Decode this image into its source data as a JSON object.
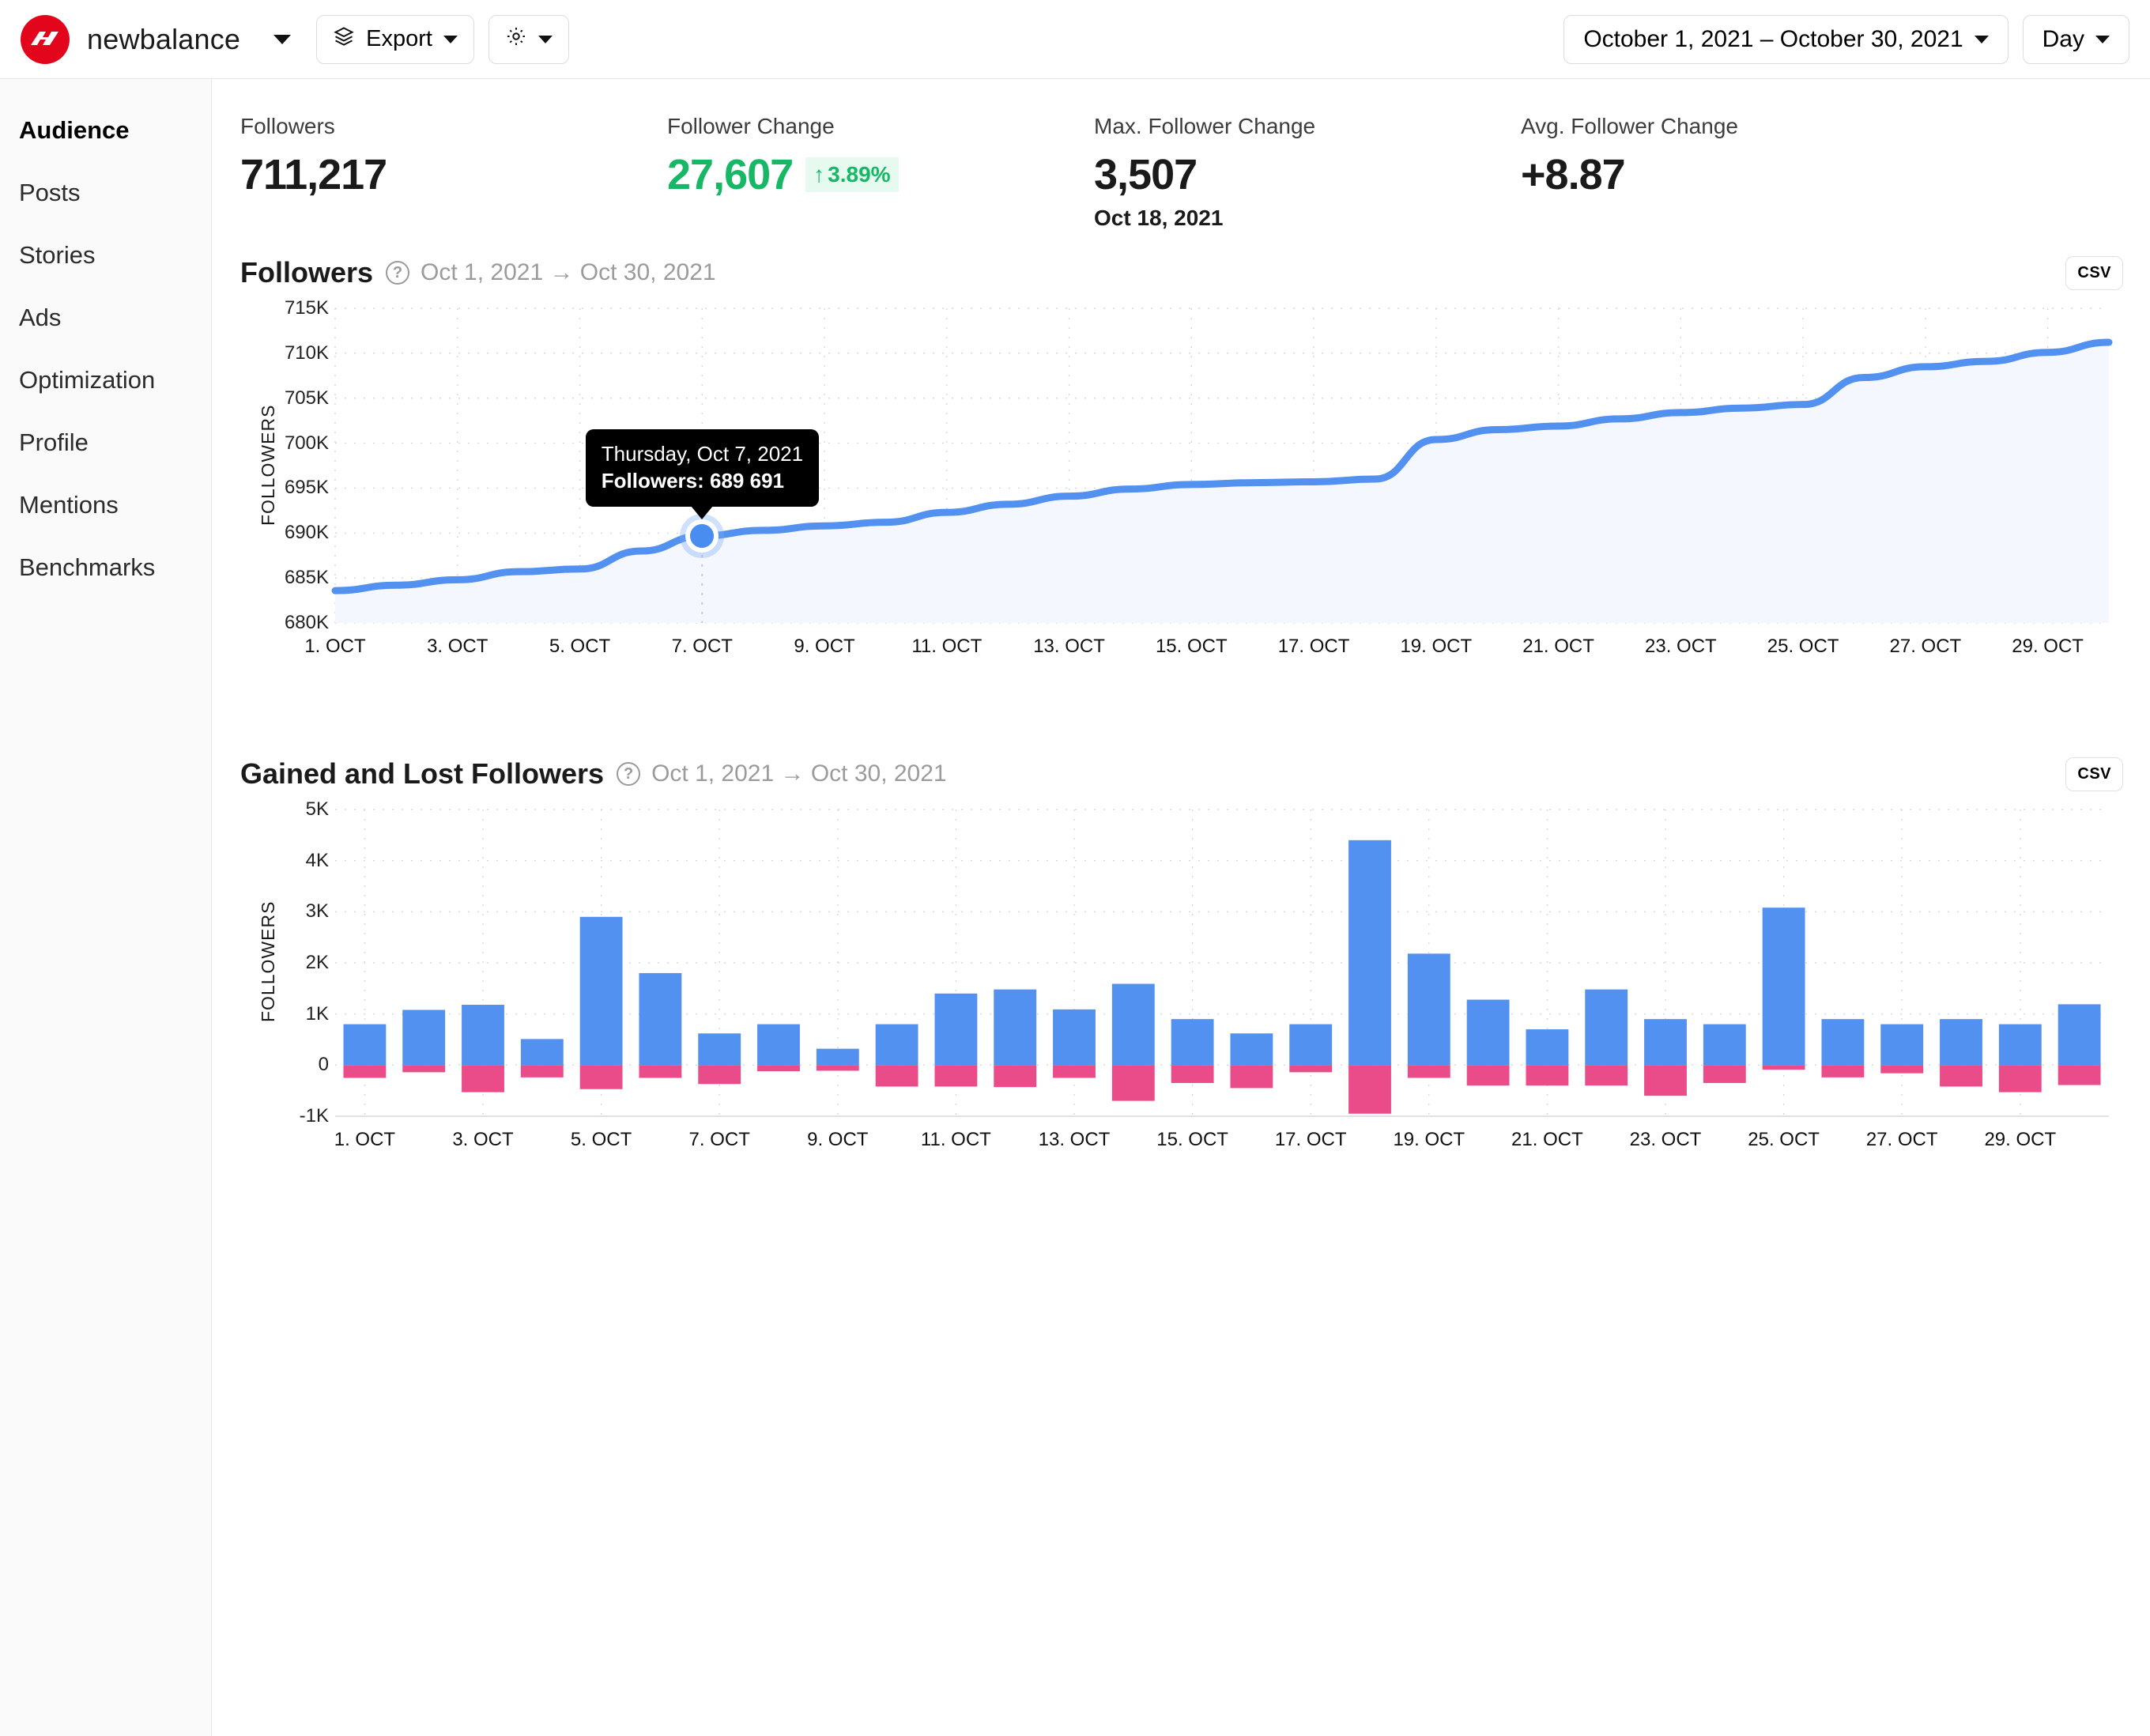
{
  "header": {
    "brand_name": "newbalance",
    "brand_logo_icon": "new-balance-logo",
    "brand_caret_icon": "chevron-down-icon",
    "export_label": "Export",
    "export_icon": "layers-icon",
    "export_caret_icon": "chevron-down-icon",
    "settings_icon": "gear-icon",
    "settings_caret_icon": "chevron-down-icon",
    "date_range": "October 1, 2021 – October 30, 2021",
    "date_range_caret_icon": "chevron-down-icon",
    "granularity": "Day",
    "granularity_caret_icon": "chevron-down-icon"
  },
  "sidebar": {
    "items": [
      {
        "label": "Audience",
        "active": true
      },
      {
        "label": "Posts",
        "active": false
      },
      {
        "label": "Stories",
        "active": false
      },
      {
        "label": "Ads",
        "active": false
      },
      {
        "label": "Optimization",
        "active": false
      },
      {
        "label": "Profile",
        "active": false
      },
      {
        "label": "Mentions",
        "active": false
      },
      {
        "label": "Benchmarks",
        "active": false
      }
    ]
  },
  "kpis": [
    {
      "label": "Followers",
      "value": "711,217",
      "badge": "",
      "sub": ""
    },
    {
      "label": "Follower Change",
      "value": "27,607",
      "badge": "3.89%",
      "badge_arrow": "↑",
      "sub": ""
    },
    {
      "label": "Max. Follower Change",
      "value": "3,507",
      "badge": "",
      "sub": "Oct 18, 2021"
    },
    {
      "label": "Avg. Follower Change",
      "value": "+8.87",
      "badge": "",
      "sub": ""
    }
  ],
  "colors": {
    "accent_blue": "#5291f0",
    "accent_pink": "#ea4c89",
    "positive_green": "#16b866",
    "positive_green_bg": "#e6faef",
    "brand_red": "#e3051b"
  },
  "followers_chart": {
    "title": "Followers",
    "help_icon": "question-circle-icon",
    "range": "Oct 1, 2021 → Oct 30, 2021",
    "csv_label": "CSV",
    "tooltip": {
      "date": "Thursday, Oct 7, 2021",
      "value": "Followers: 689 691"
    }
  },
  "gained_lost_chart": {
    "title": "Gained and Lost Followers",
    "help_icon": "question-circle-icon",
    "range": "Oct 1, 2021 → Oct 30, 2021",
    "csv_label": "CSV"
  },
  "chart_data": [
    {
      "type": "area",
      "title": "Followers",
      "xlabel": "",
      "ylabel": "FOLLOWERS",
      "ylim": [
        680000,
        715000
      ],
      "yticks": [
        680000,
        685000,
        690000,
        695000,
        700000,
        705000,
        710000,
        715000
      ],
      "ytick_labels": [
        "680K",
        "685K",
        "690K",
        "695K",
        "700K",
        "705K",
        "710K",
        "715K"
      ],
      "grid": true,
      "legend": "none",
      "x": [
        "1. OCT",
        "2. OCT",
        "3. OCT",
        "4. OCT",
        "5. OCT",
        "6. OCT",
        "7. OCT",
        "8. OCT",
        "9. OCT",
        "10. OCT",
        "11. OCT",
        "12. OCT",
        "13. OCT",
        "14. OCT",
        "15. OCT",
        "16. OCT",
        "17. OCT",
        "18. OCT",
        "19. OCT",
        "20. OCT",
        "21. OCT",
        "22. OCT",
        "23. OCT",
        "24. OCT",
        "25. OCT",
        "26. OCT",
        "27. OCT",
        "28. OCT",
        "29. OCT",
        "30. OCT"
      ],
      "xtick_labels": [
        "1. OCT",
        "3. OCT",
        "5. OCT",
        "7. OCT",
        "9. OCT",
        "11. OCT",
        "13. OCT",
        "15. OCT",
        "17. OCT",
        "19. OCT",
        "21. OCT",
        "23. OCT",
        "25. OCT",
        "27. OCT",
        "29. OCT"
      ],
      "series": [
        {
          "name": "Followers",
          "color": "#5291f0",
          "values": [
            683600,
            684200,
            684800,
            685700,
            686000,
            688000,
            689691,
            690300,
            690800,
            691200,
            692300,
            693200,
            694100,
            694900,
            695400,
            695600,
            695700,
            696000,
            700400,
            701500,
            701900,
            702700,
            703400,
            703900,
            704300,
            707300,
            708500,
            709100,
            710100,
            711217
          ]
        }
      ],
      "highlight_point": {
        "x": "7. OCT",
        "y": 689691,
        "label_date": "Thursday, Oct 7, 2021",
        "label_value": "Followers: 689 691"
      }
    },
    {
      "type": "bar",
      "title": "Gained and Lost Followers",
      "xlabel": "",
      "ylabel": "FOLLOWERS",
      "ylim": [
        -1000,
        5000
      ],
      "yticks": [
        -1000,
        0,
        1000,
        2000,
        3000,
        4000,
        5000
      ],
      "ytick_labels": [
        "-1K",
        "0",
        "1K",
        "2K",
        "3K",
        "4K",
        "5K"
      ],
      "grid": true,
      "stacked": true,
      "legend": "none",
      "categories": [
        "1. OCT",
        "2. OCT",
        "3. OCT",
        "4. OCT",
        "5. OCT",
        "6. OCT",
        "7. OCT",
        "8. OCT",
        "9. OCT",
        "10. OCT",
        "11. OCT",
        "12. OCT",
        "13. OCT",
        "14. OCT",
        "15. OCT",
        "16. OCT",
        "17. OCT",
        "18. OCT",
        "19. OCT",
        "20. OCT",
        "21. OCT",
        "22. OCT",
        "23. OCT",
        "24. OCT",
        "25. OCT",
        "26. OCT",
        "27. OCT",
        "28. OCT",
        "29. OCT",
        "30. OCT"
      ],
      "xtick_labels": [
        "1. OCT",
        "3. OCT",
        "5. OCT",
        "7. OCT",
        "9. OCT",
        "11. OCT",
        "13. OCT",
        "15. OCT",
        "17. OCT",
        "19. OCT",
        "21. OCT",
        "23. OCT",
        "25. OCT",
        "27. OCT",
        "29. OCT"
      ],
      "series": [
        {
          "name": "Gained",
          "color": "#5291f0",
          "values": [
            800,
            1080,
            1180,
            510,
            2900,
            1800,
            620,
            800,
            320,
            800,
            1400,
            1480,
            1090,
            1590,
            900,
            620,
            800,
            4400,
            2180,
            1280,
            700,
            1480,
            900,
            800,
            3080,
            900,
            800,
            900,
            800,
            1190
          ]
        },
        {
          "name": "Lost",
          "color": "#ea4c89",
          "values": [
            -250,
            -140,
            -530,
            -240,
            -470,
            -250,
            -370,
            -120,
            -110,
            -420,
            -420,
            -430,
            -250,
            -700,
            -350,
            -450,
            -140,
            -950,
            -250,
            -400,
            -400,
            -400,
            -600,
            -350,
            -90,
            -240,
            -160,
            -420,
            -530,
            -390
          ]
        }
      ]
    }
  ]
}
